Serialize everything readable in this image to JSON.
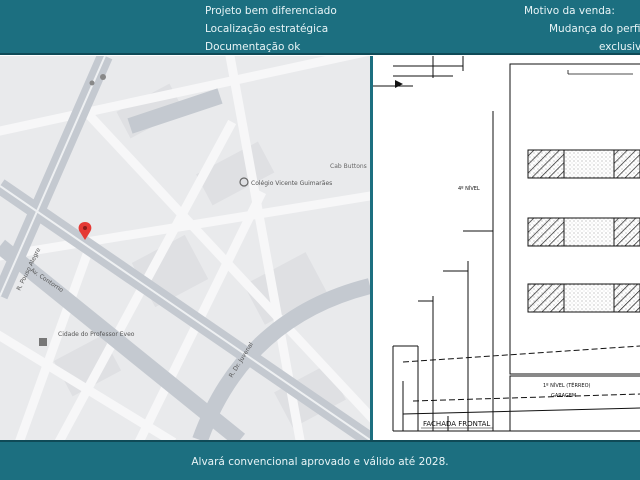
{
  "header": {
    "features": [
      "Projeto bem diferenciado",
      "Localização estratégica",
      "Documentação ok"
    ],
    "motivo_label": "Motivo da venda:",
    "motivo_line1": "Mudança do perfil d",
    "motivo_line2": "exclusiva"
  },
  "map": {
    "labels": {
      "place1": "Colégio Vicente Guimarães",
      "place2": "Cab Buttons",
      "place3": "Cidade do Professor Eveo",
      "street1": "R. Pouso Alegre",
      "street2": "Av. Contorno",
      "street3": "R. Dr. Juvenal"
    }
  },
  "plan": {
    "labels": {
      "nivel4": "4º NÍVEL",
      "nivel1": "1º NÍVEL (TÉRREO)",
      "garagem": "GARAGEM",
      "fachada": "FACHADA FRONTAL"
    }
  },
  "footer": {
    "text": "Alvará convencional  aprovado e válido até 2028."
  },
  "colors": {
    "bar": "#1c6f80",
    "pin": "#e53935"
  }
}
